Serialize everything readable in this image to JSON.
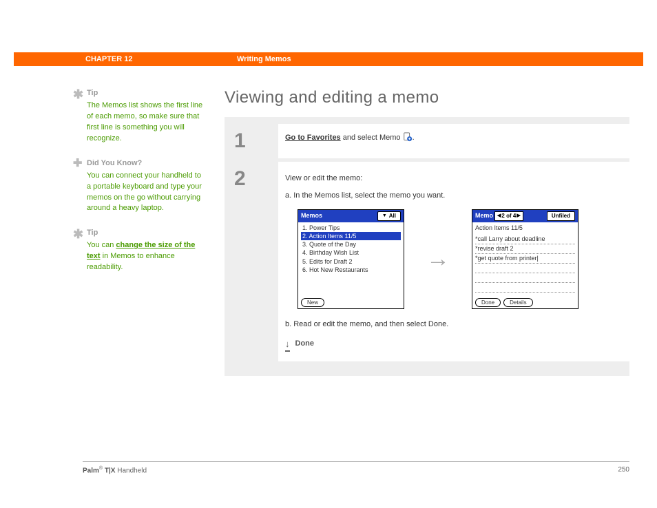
{
  "header": {
    "chapter": "CHAPTER 12",
    "section": "Writing Memos"
  },
  "sidebar": {
    "tip1": {
      "title": "Tip",
      "body": "The Memos list shows the first line of each memo, so make sure that first line is something you will recognize."
    },
    "dyk": {
      "title": "Did You Know?",
      "body": "You can connect your handheld to a portable keyboard and type your memos on the go without carrying around a heavy laptop."
    },
    "tip2": {
      "title": "Tip",
      "pre": "You can ",
      "link": "change the size of the text",
      "post": " in Memos to enhance readability."
    }
  },
  "main": {
    "heading": "Viewing and editing a memo",
    "step1": {
      "num": "1",
      "link": "Go to Favorites",
      "rest": " and select Memo ",
      "period": "."
    },
    "step2": {
      "num": "2",
      "intro": "View or edit the memo:",
      "a": "a.  In the Memos list, select the memo you want.",
      "b": "b.  Read or edit the memo, and then select Done.",
      "done": "Done"
    }
  },
  "screens": {
    "list": {
      "title": "Memos",
      "category": "All",
      "items": [
        "1. Power Tips",
        "2. Action Items 11/5",
        "3. Quote of the Day",
        "4. Birthday Wish List",
        "5. Edits for Draft 2",
        "6. Hot New Restaurants"
      ],
      "selectedIndex": 1,
      "buttons": [
        "New"
      ]
    },
    "detail": {
      "title": "Memo",
      "nav": "2 of 4",
      "category": "Unfiled",
      "heading": "Action Items 11/5",
      "lines": [
        "*call Larry about deadline",
        "*revise draft 2",
        "*get quote from printer|"
      ],
      "buttons": [
        "Done",
        "Details"
      ]
    }
  },
  "footer": {
    "brand_strong": "Palm",
    "reg": "®",
    "brand_mid": " T|X ",
    "brand_rest": "Handheld",
    "page": "250"
  }
}
